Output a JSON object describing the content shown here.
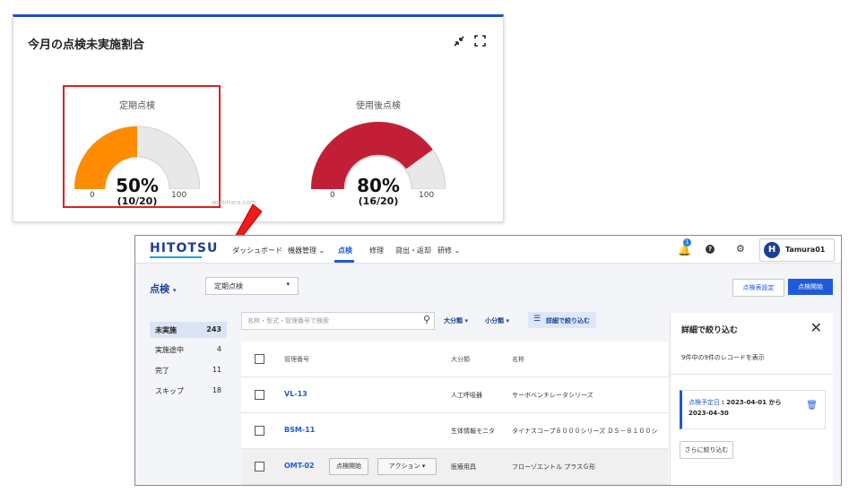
{
  "widget": {
    "title": "今月の点検未実施割合",
    "collapse_icon": "collapse-arrows-icon",
    "expand_icon": "fullscreen-icon",
    "gauges": [
      {
        "label": "定期点検",
        "percent_text": "50%",
        "fraction_text": "(10/20)",
        "min": "0",
        "max": "100",
        "value": 50,
        "color": "#ff8c00"
      },
      {
        "label": "使用後点検",
        "percent_text": "80%",
        "fraction_text": "(16/20)",
        "min": "0",
        "max": "100",
        "value": 80,
        "color": "#c11f35"
      }
    ],
    "track_color": "#e8e8e8",
    "highlight_color": "#e01e1e",
    "watermark": "wubinara.com"
  },
  "app": {
    "logo": "HITOTSU",
    "nav": [
      "ダッシュボード",
      "機器管理",
      "点検",
      "修理",
      "貸出・返却",
      "研修"
    ],
    "notification_count": "1",
    "user": {
      "initial": "H",
      "name": "Tamura01"
    },
    "page_title": "点検",
    "type_select_value": "定期点検",
    "buttons": {
      "schedule": "点検表設定",
      "start": "点検開始"
    },
    "sidebar": [
      {
        "label": "未実施",
        "count": "243"
      },
      {
        "label": "実施途中",
        "count": "4"
      },
      {
        "label": "完了",
        "count": "11"
      },
      {
        "label": "スキップ",
        "count": "18"
      }
    ],
    "search_placeholder": "名称・型式・管理番号で検索",
    "filters": {
      "major": "大分類",
      "minor": "小分類",
      "detail": "詳細で絞り込む"
    },
    "table": {
      "headers": [
        "管理番号",
        "大分類",
        "名称"
      ],
      "rows": [
        {
          "id": "VL-13",
          "category": "人工呼吸器",
          "name": "サーボベンチレータシリーズ"
        },
        {
          "id": "BSM-11",
          "category": "生体情報モニタ",
          "name": "タイナスコープ８０００シリーズ ＤＳ－８１００シ"
        },
        {
          "id": "OMT-02",
          "category": "医療用具",
          "name": "フローゾエントル プラスＧ形",
          "start_btn": "点検開始",
          "action_btn": "アクション"
        }
      ]
    },
    "panel": {
      "title": "詳細で絞り込む",
      "summary": "9件中の9件のレコードを表示",
      "filter_key": "点検予定日",
      "filter_value_line1": ": 2023-04-01 から",
      "filter_value_line2": "2023-04-30",
      "more_button": "さらに絞り込む"
    }
  }
}
